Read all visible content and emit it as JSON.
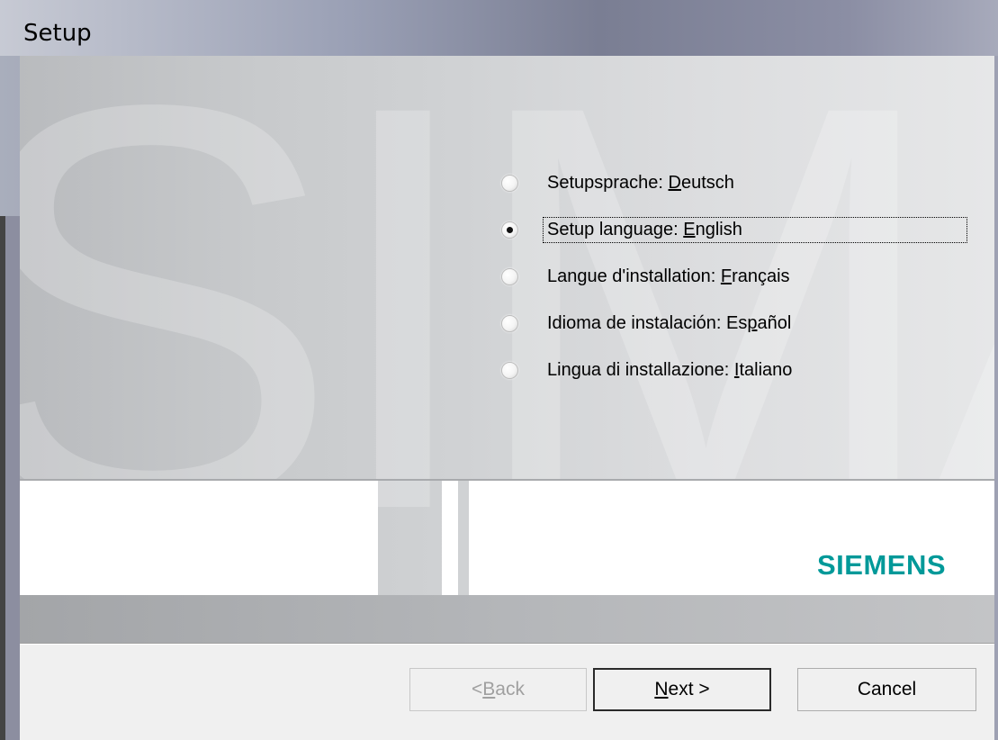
{
  "window": {
    "title": "Setup"
  },
  "languages": [
    {
      "prefix": "Setupsprache: ",
      "accel": "D",
      "rest": "eutsch",
      "selected": false
    },
    {
      "prefix": "Setup language: ",
      "accel": "E",
      "rest": "nglish",
      "selected": true
    },
    {
      "prefix": "Langue d'installation: ",
      "accel": "F",
      "rest": "rançais",
      "selected": false
    },
    {
      "prefix": "Idioma de instalación: Es",
      "accel": "p",
      "rest": "añol",
      "selected": false
    },
    {
      "prefix": "Lingua di installazione: ",
      "accel": "I",
      "rest": "taliano",
      "selected": false
    }
  ],
  "banner": {
    "background_text": "SIMA",
    "logo": "SIEMENS",
    "logo_color": "#009999"
  },
  "buttons": {
    "back": {
      "prefix": "< ",
      "accel": "B",
      "rest": "ack",
      "enabled": false
    },
    "next": {
      "prefix": "",
      "accel": "N",
      "rest": "ext >",
      "enabled": true
    },
    "cancel": {
      "label": "Cancel",
      "enabled": true
    }
  }
}
